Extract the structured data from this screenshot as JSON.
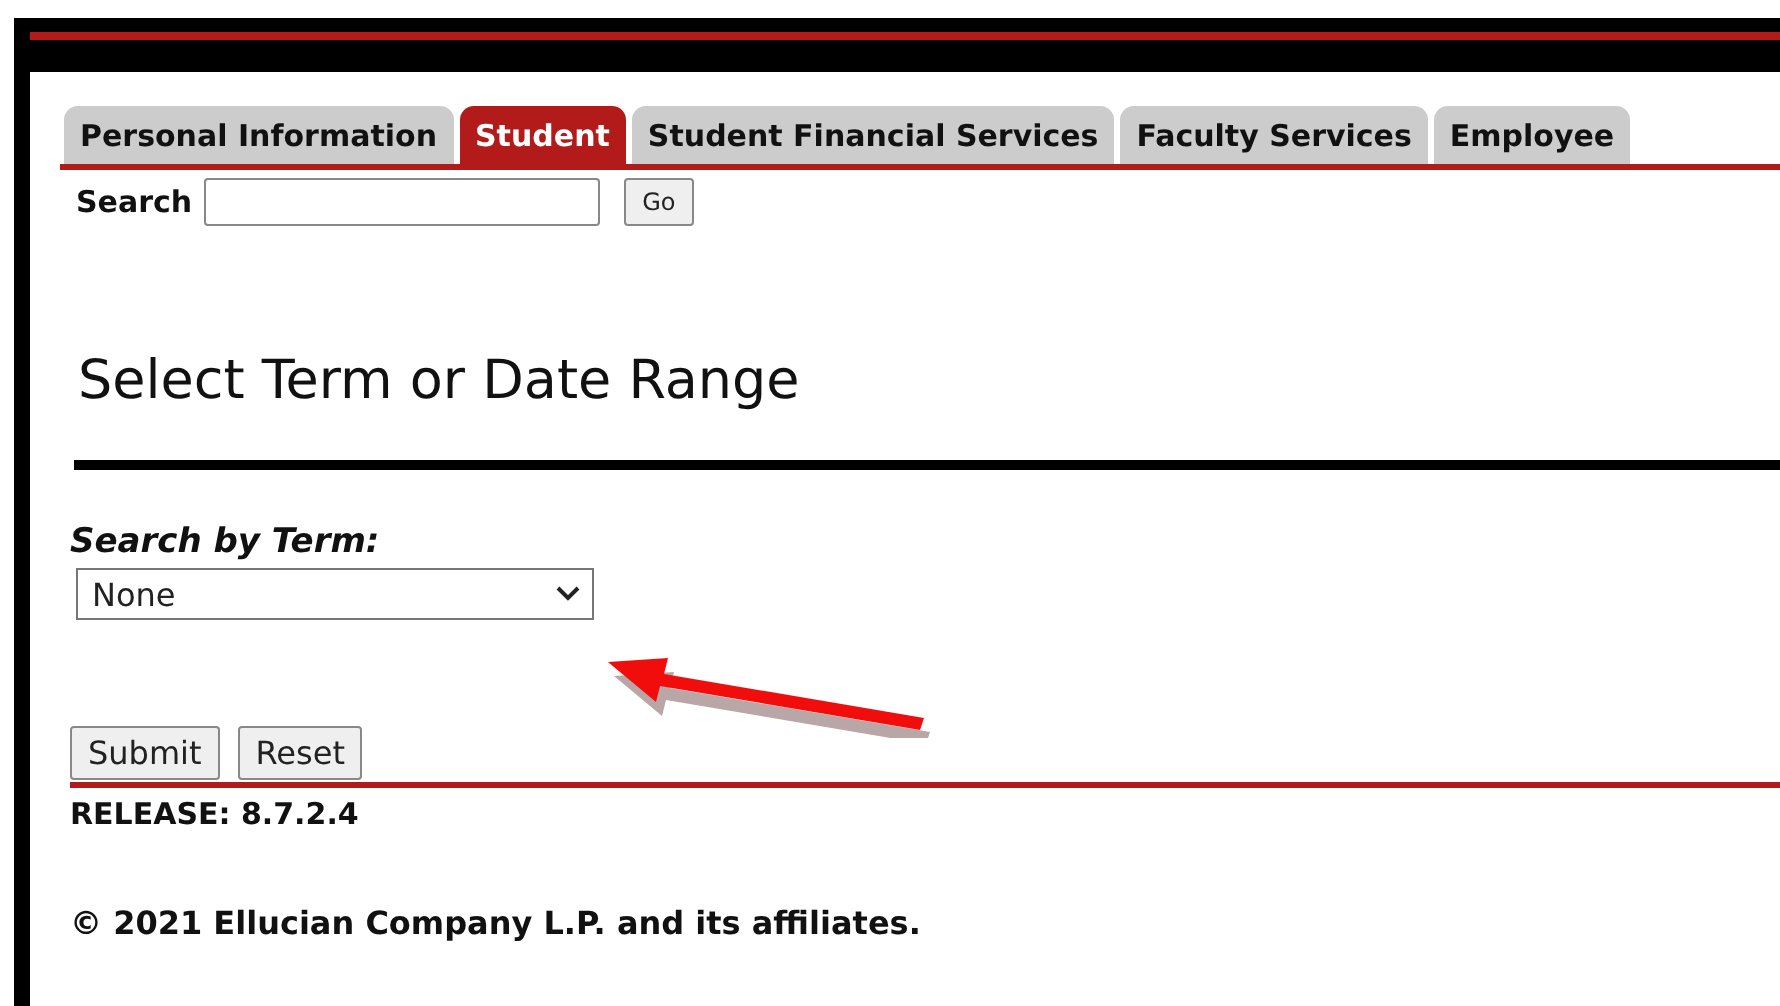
{
  "tabs": [
    {
      "label": "Personal Information",
      "selected": false
    },
    {
      "label": "Student",
      "selected": true
    },
    {
      "label": "Student Financial Services",
      "selected": false
    },
    {
      "label": "Faculty Services",
      "selected": false
    },
    {
      "label": "Employee",
      "selected": false
    }
  ],
  "search": {
    "label": "Search",
    "button": "Go"
  },
  "title": "Select Term or Date Range",
  "term": {
    "label": "Search by Term:",
    "value": "None"
  },
  "buttons": [
    "Submit",
    "Reset"
  ],
  "release": "RELEASE: 8.7.2.4",
  "copyright": "© 2021 Ellucian Company L.P. and its affiliates."
}
